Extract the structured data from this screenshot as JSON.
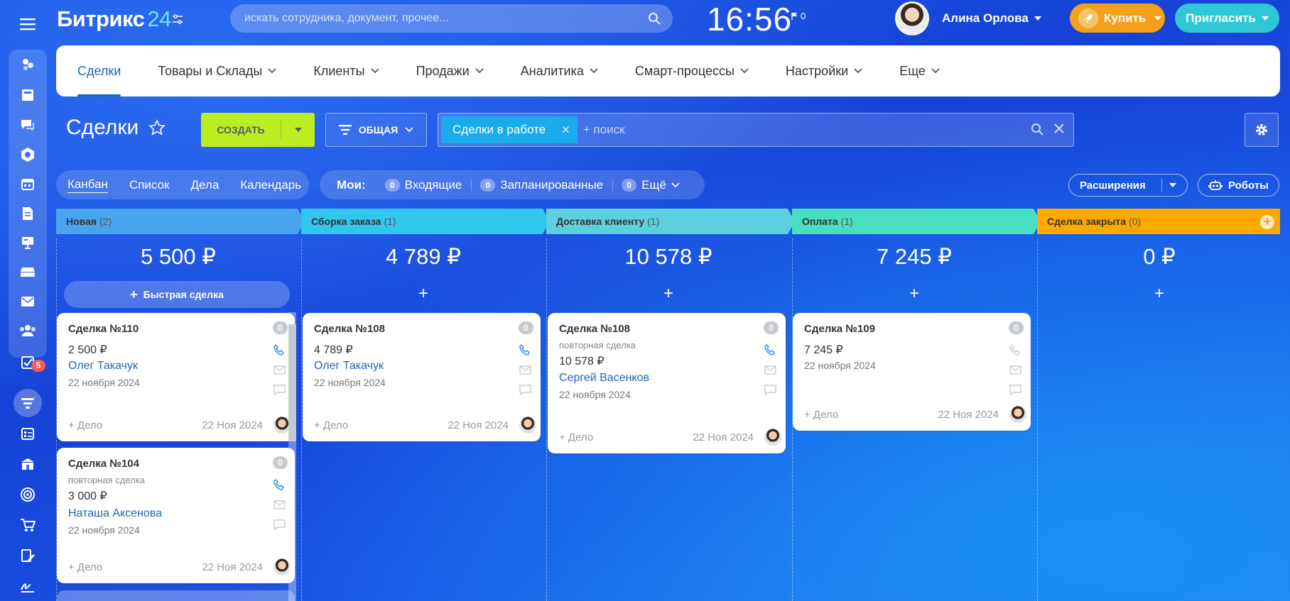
{
  "header": {
    "logo": "Битрикс",
    "logo_num": "24",
    "search_placeholder": "искать сотрудника, документ, прочее...",
    "time": "16:56",
    "flag_count": "0",
    "user_name": "Алина Орлова",
    "buy_label": "Купить",
    "invite_label": "Пригласить"
  },
  "sidebar": {
    "badge": "5",
    "items": [
      "burger-menu",
      "feed",
      "chat",
      "messenger",
      "bitrix-tasks",
      "calendar",
      "documents",
      "boards",
      "storage",
      "mail",
      "employees",
      "tasks",
      "crm-funnel",
      "crm-forms",
      "store",
      "goals",
      "shop",
      "doc-sign",
      "signature"
    ]
  },
  "nav": {
    "items": [
      {
        "label": "Сделки",
        "active": true
      },
      {
        "label": "Товары и Склады"
      },
      {
        "label": "Клиенты"
      },
      {
        "label": "Продажи"
      },
      {
        "label": "Аналитика"
      },
      {
        "label": "Смарт-процессы"
      },
      {
        "label": "Настройки"
      },
      {
        "label": "Еще"
      }
    ]
  },
  "toolbar": {
    "title": "Сделки",
    "create_label": "СОЗДАТЬ",
    "preset_label": "ОБЩАЯ",
    "filter_chip": "Сделки в работе",
    "filter_placeholder": "+ поиск"
  },
  "views": {
    "items": [
      "Канбан",
      "Список",
      "Дела",
      "Календарь"
    ],
    "my_label": "Мои:",
    "counters": [
      {
        "count": "0",
        "label": "Входящие"
      },
      {
        "count": "0",
        "label": "Запланированные"
      },
      {
        "count": "0",
        "label": "Ещё"
      }
    ],
    "extensions_label": "Расширения",
    "robots_label": "Роботы"
  },
  "colors": {
    "stage_new": "#48a5ee",
    "stage_assembly": "#30c6ee",
    "stage_delivery": "#5dd0df",
    "stage_payment": "#47dfc0",
    "stage_closed": "#ffa800",
    "create": "#bbed21",
    "buy": "#f3a11a",
    "invite": "#2fc7d6"
  },
  "kanban": {
    "quick_deal": "Быстрая сделка",
    "add_activity": "+ Дело",
    "columns": [
      {
        "name": "Новая",
        "count": "(2)",
        "sum": "5 500 ₽",
        "cards": [
          {
            "title": "Сделка №110",
            "subtitle": "",
            "amount": "2 500 ₽",
            "client": "Олег Такачук",
            "date": "22 ноября 2024",
            "activity_date": "22 Ноя 2024",
            "badge": "0"
          },
          {
            "title": "Сделка №104",
            "subtitle": "повторная сделка",
            "amount": "3 000 ₽",
            "client": "Наташа Аксенова",
            "date": "22 ноября 2024",
            "activity_date": "22 Ноя 2024",
            "badge": "0"
          }
        ]
      },
      {
        "name": "Сборка заказа",
        "count": "(1)",
        "sum": "4 789 ₽",
        "cards": [
          {
            "title": "Сделка №108",
            "subtitle": "",
            "amount": "4 789 ₽",
            "client": "Олег Такачук",
            "date": "22 ноября 2024",
            "activity_date": "22 Ноя 2024",
            "badge": "0"
          }
        ]
      },
      {
        "name": "Доставка клиенту",
        "count": "(1)",
        "sum": "10 578 ₽",
        "cards": [
          {
            "title": "Сделка №108",
            "subtitle": "повторная сделка",
            "amount": "10 578 ₽",
            "client": "Сергей Васенков",
            "date": "22 ноября 2024",
            "activity_date": "22 Ноя 2024",
            "badge": "0"
          }
        ]
      },
      {
        "name": "Оплата",
        "count": "(1)",
        "sum": "7 245 ₽",
        "cards": [
          {
            "title": "Сделка №109",
            "subtitle": "",
            "amount": "7 245 ₽",
            "client": "",
            "date": "22 ноября 2024",
            "activity_date": "22 Ноя 2024",
            "badge": "0"
          }
        ]
      },
      {
        "name": "Сделка закрыта",
        "count": "(0)",
        "sum": "0 ₽",
        "cards": []
      }
    ]
  }
}
